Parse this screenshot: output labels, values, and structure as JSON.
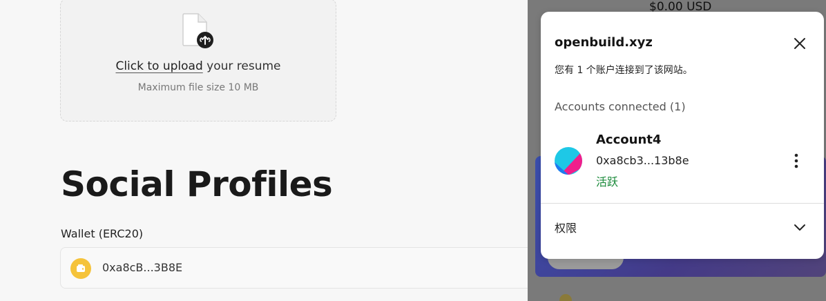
{
  "upload": {
    "link_text": "Click to upload",
    "rest_text": " your resume",
    "hint": "Maximum file size 10 MB",
    "icon": "file-upload-icon"
  },
  "profiles": {
    "title": "Social Profiles",
    "wallet_label": "Wallet (ERC20)",
    "wallet_address": "0xa8cB...3B8E",
    "wallet_icon": "wallet-icon"
  },
  "background": {
    "balance": "$0.00 USD"
  },
  "popup": {
    "site": "openbuild.xyz",
    "subtitle": "您有 1 个账户连接到了该网站。",
    "accounts_heading": "Accounts connected (1)",
    "account": {
      "name": "Account4",
      "address": "0xa8cb3...13b8e",
      "status": "活跃",
      "status_color": "#1a8a3a"
    },
    "permissions_label": "权限",
    "icons": {
      "close": "close-icon",
      "more": "more-vertical-icon",
      "expand": "chevron-down-icon"
    }
  },
  "colors": {
    "wallet_badge": "#f5c33b",
    "overlay": "#7a7a7a"
  }
}
